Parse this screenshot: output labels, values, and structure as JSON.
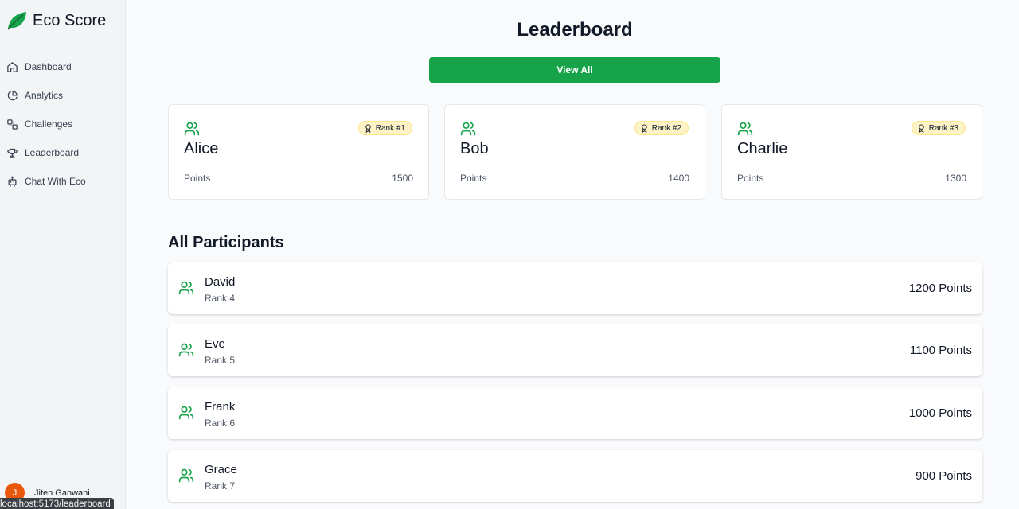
{
  "app": {
    "name": "Eco Score"
  },
  "sidebar": {
    "items": [
      {
        "label": "Dashboard",
        "icon": "home-icon"
      },
      {
        "label": "Analytics",
        "icon": "pie-chart-icon"
      },
      {
        "label": "Challenges",
        "icon": "puzzle-icon"
      },
      {
        "label": "Leaderboard",
        "icon": "trophy-icon"
      },
      {
        "label": "Chat With Eco",
        "icon": "bot-icon"
      }
    ],
    "user": {
      "initial": "J",
      "name": "Jiten Ganwani"
    }
  },
  "status_bar": {
    "url": "localhost:5173/leaderboard"
  },
  "main": {
    "title": "Leaderboard",
    "view_all_label": "View All",
    "top_three": [
      {
        "name": "Alice",
        "rank_badge": "Rank #1",
        "points_label": "Points",
        "points": "1500"
      },
      {
        "name": "Bob",
        "rank_badge": "Rank #2",
        "points_label": "Points",
        "points": "1400"
      },
      {
        "name": "Charlie",
        "rank_badge": "Rank #3",
        "points_label": "Points",
        "points": "1300"
      }
    ],
    "participants_title": "All Participants",
    "participants": [
      {
        "name": "David",
        "rank": "Rank 4",
        "points": "1200 Points"
      },
      {
        "name": "Eve",
        "rank": "Rank 5",
        "points": "1100 Points"
      },
      {
        "name": "Frank",
        "rank": "Rank 6",
        "points": "1000 Points"
      },
      {
        "name": "Grace",
        "rank": "Rank 7",
        "points": "900 Points"
      }
    ]
  },
  "colors": {
    "accent": "#16a34a",
    "badge_bg": "#fef3c7",
    "avatar": "#ea580c"
  }
}
